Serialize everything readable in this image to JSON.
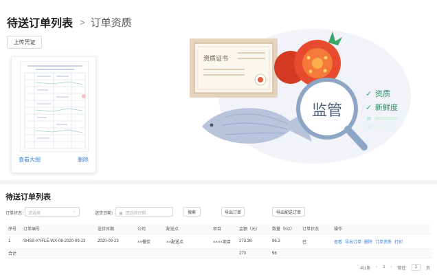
{
  "breadcrumb": {
    "parent": "待送订单列表",
    "separator": ">",
    "current": "订单资质"
  },
  "upload_button": "上传凭证",
  "document_card": {
    "heading_line1": "××××××××××××××××××××××××××××（××）",
    "heading_line2": "××  ××  ××  ××",
    "view_label": "查看大图",
    "delete_label": "删除"
  },
  "illustration": {
    "certificate_title": "资质证书",
    "magnifier_text": "监管",
    "check_items": [
      "资质",
      "新鲜度"
    ],
    "accent_color": "#2faa74",
    "tomato_color": "#e84a2f",
    "magnifier_color": "#8ea6c6"
  },
  "order_list": {
    "title": "待送订单列表",
    "filters": {
      "status_label": "订单状态：",
      "status_placeholder": "请选择",
      "date_label": "送货日期：",
      "date_placeholder": "请选择日期",
      "search_label": "搜索",
      "export_orders_label": "导出订单",
      "export_delivery_label": "导出配送订单"
    },
    "columns": [
      "序号",
      "订单编号",
      "送货日期",
      "公司",
      "配送点",
      "项目",
      "金额（元）",
      "数量（KG）",
      "订单状态",
      "操作"
    ],
    "rows": [
      {
        "index": "1",
        "order_no": "SHSS-XYFLE-WX-08-2020-09-23",
        "date": "2020-09-23",
        "company": "××餐饮",
        "point": "××配送点",
        "project": "××××项目",
        "amount": "273.36",
        "qty": "96.3",
        "status": "已",
        "actions": [
          "查看",
          "导出订单",
          "删除",
          "订单资质",
          "打印"
        ]
      }
    ],
    "summary": {
      "label": "合计",
      "amount": "273",
      "qty": "96"
    },
    "pagination": {
      "total": "共1条",
      "page": "1",
      "goto_label": "前往",
      "goto_value": "1",
      "page_unit": "页",
      "prev": "‹",
      "next": "›"
    }
  }
}
